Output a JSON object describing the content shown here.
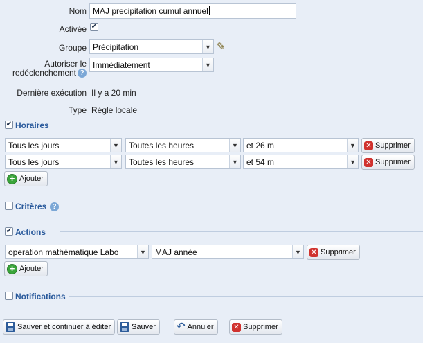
{
  "form": {
    "nom_label": "Nom",
    "nom_value": "MAJ precipitation cumul annuel",
    "activee_label": "Activée",
    "activee_checked": true,
    "groupe_label": "Groupe",
    "groupe_value": "Précipitation",
    "autoriser_label_1": "Autoriser le",
    "autoriser_label_2": "redéclenchement",
    "autoriser_value": "Immédiatement",
    "derniere_label": "Dernière exécution",
    "derniere_value": "Il y a 20 min",
    "type_label": "Type",
    "type_value": "Règle locale"
  },
  "horaires": {
    "title": "Horaires",
    "checked": true,
    "rows": [
      {
        "jours": "Tous les jours",
        "heures": "Toutes les heures",
        "minutes": "et 26 m",
        "delete_label": "Supprimer"
      },
      {
        "jours": "Tous les jours",
        "heures": "Toutes les heures",
        "minutes": "et 54 m",
        "delete_label": "Supprimer"
      }
    ],
    "add_label": "Ajouter"
  },
  "criteres": {
    "title": "Critères",
    "checked": false
  },
  "actions": {
    "title": "Actions",
    "checked": true,
    "rows": [
      {
        "operation": "operation mathématique Labo",
        "target": "MAJ année",
        "delete_label": "Supprimer"
      }
    ],
    "add_label": "Ajouter"
  },
  "notifications": {
    "title": "Notifications",
    "checked": false
  },
  "footer": {
    "save_continue_label": "Sauver et continuer à éditer",
    "save_label": "Sauver",
    "cancel_label": "Annuler",
    "delete_label": "Supprimer"
  },
  "icons": {
    "checkbox_checked": "check-icon",
    "delete": "delete-icon",
    "add": "add-icon",
    "help": "help-icon",
    "edit": "pencil-icon",
    "save": "floppy-icon",
    "undo": "undo-icon"
  },
  "colors": {
    "background": "#e8eef7",
    "section_title": "#2a5a9c",
    "delete_red": "#d0322e",
    "add_green": "#3aa53a"
  }
}
